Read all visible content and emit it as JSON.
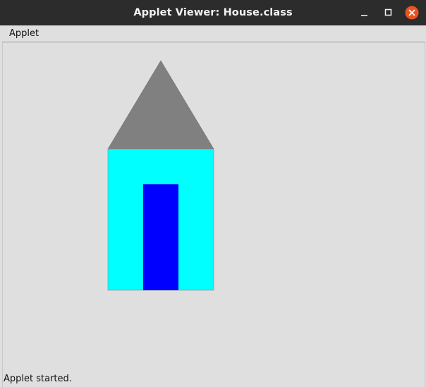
{
  "window": {
    "title": "Applet Viewer: House.class",
    "controls": {
      "minimize_icon": "minimize-icon",
      "maximize_icon": "maximize-icon",
      "close_icon": "close-icon",
      "close_color": "#e95420"
    }
  },
  "menubar": {
    "items": [
      {
        "label": "Applet"
      }
    ]
  },
  "drawing": {
    "background": "#dfdfdf",
    "roof_color": "#808080",
    "wall_color": "#00ffff",
    "door_color": "#0000ff"
  },
  "status": {
    "text": "Applet started."
  }
}
